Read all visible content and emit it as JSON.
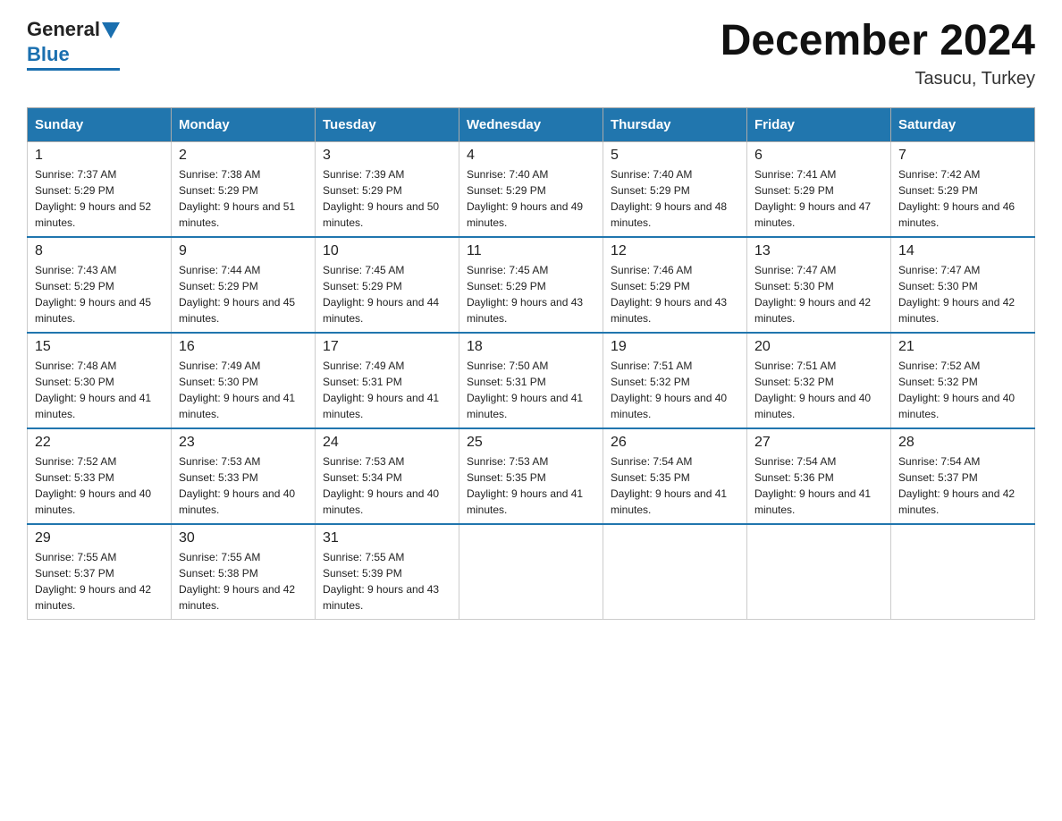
{
  "header": {
    "title": "December 2024",
    "subtitle": "Tasucu, Turkey",
    "logo_general": "General",
    "logo_blue": "Blue"
  },
  "days_of_week": [
    "Sunday",
    "Monday",
    "Tuesday",
    "Wednesday",
    "Thursday",
    "Friday",
    "Saturday"
  ],
  "weeks": [
    [
      {
        "day": "1",
        "sunrise": "7:37 AM",
        "sunset": "5:29 PM",
        "daylight": "9 hours and 52 minutes."
      },
      {
        "day": "2",
        "sunrise": "7:38 AM",
        "sunset": "5:29 PM",
        "daylight": "9 hours and 51 minutes."
      },
      {
        "day": "3",
        "sunrise": "7:39 AM",
        "sunset": "5:29 PM",
        "daylight": "9 hours and 50 minutes."
      },
      {
        "day": "4",
        "sunrise": "7:40 AM",
        "sunset": "5:29 PM",
        "daylight": "9 hours and 49 minutes."
      },
      {
        "day": "5",
        "sunrise": "7:40 AM",
        "sunset": "5:29 PM",
        "daylight": "9 hours and 48 minutes."
      },
      {
        "day": "6",
        "sunrise": "7:41 AM",
        "sunset": "5:29 PM",
        "daylight": "9 hours and 47 minutes."
      },
      {
        "day": "7",
        "sunrise": "7:42 AM",
        "sunset": "5:29 PM",
        "daylight": "9 hours and 46 minutes."
      }
    ],
    [
      {
        "day": "8",
        "sunrise": "7:43 AM",
        "sunset": "5:29 PM",
        "daylight": "9 hours and 45 minutes."
      },
      {
        "day": "9",
        "sunrise": "7:44 AM",
        "sunset": "5:29 PM",
        "daylight": "9 hours and 45 minutes."
      },
      {
        "day": "10",
        "sunrise": "7:45 AM",
        "sunset": "5:29 PM",
        "daylight": "9 hours and 44 minutes."
      },
      {
        "day": "11",
        "sunrise": "7:45 AM",
        "sunset": "5:29 PM",
        "daylight": "9 hours and 43 minutes."
      },
      {
        "day": "12",
        "sunrise": "7:46 AM",
        "sunset": "5:29 PM",
        "daylight": "9 hours and 43 minutes."
      },
      {
        "day": "13",
        "sunrise": "7:47 AM",
        "sunset": "5:30 PM",
        "daylight": "9 hours and 42 minutes."
      },
      {
        "day": "14",
        "sunrise": "7:47 AM",
        "sunset": "5:30 PM",
        "daylight": "9 hours and 42 minutes."
      }
    ],
    [
      {
        "day": "15",
        "sunrise": "7:48 AM",
        "sunset": "5:30 PM",
        "daylight": "9 hours and 41 minutes."
      },
      {
        "day": "16",
        "sunrise": "7:49 AM",
        "sunset": "5:30 PM",
        "daylight": "9 hours and 41 minutes."
      },
      {
        "day": "17",
        "sunrise": "7:49 AM",
        "sunset": "5:31 PM",
        "daylight": "9 hours and 41 minutes."
      },
      {
        "day": "18",
        "sunrise": "7:50 AM",
        "sunset": "5:31 PM",
        "daylight": "9 hours and 41 minutes."
      },
      {
        "day": "19",
        "sunrise": "7:51 AM",
        "sunset": "5:32 PM",
        "daylight": "9 hours and 40 minutes."
      },
      {
        "day": "20",
        "sunrise": "7:51 AM",
        "sunset": "5:32 PM",
        "daylight": "9 hours and 40 minutes."
      },
      {
        "day": "21",
        "sunrise": "7:52 AM",
        "sunset": "5:32 PM",
        "daylight": "9 hours and 40 minutes."
      }
    ],
    [
      {
        "day": "22",
        "sunrise": "7:52 AM",
        "sunset": "5:33 PM",
        "daylight": "9 hours and 40 minutes."
      },
      {
        "day": "23",
        "sunrise": "7:53 AM",
        "sunset": "5:33 PM",
        "daylight": "9 hours and 40 minutes."
      },
      {
        "day": "24",
        "sunrise": "7:53 AM",
        "sunset": "5:34 PM",
        "daylight": "9 hours and 40 minutes."
      },
      {
        "day": "25",
        "sunrise": "7:53 AM",
        "sunset": "5:35 PM",
        "daylight": "9 hours and 41 minutes."
      },
      {
        "day": "26",
        "sunrise": "7:54 AM",
        "sunset": "5:35 PM",
        "daylight": "9 hours and 41 minutes."
      },
      {
        "day": "27",
        "sunrise": "7:54 AM",
        "sunset": "5:36 PM",
        "daylight": "9 hours and 41 minutes."
      },
      {
        "day": "28",
        "sunrise": "7:54 AM",
        "sunset": "5:37 PM",
        "daylight": "9 hours and 42 minutes."
      }
    ],
    [
      {
        "day": "29",
        "sunrise": "7:55 AM",
        "sunset": "5:37 PM",
        "daylight": "9 hours and 42 minutes."
      },
      {
        "day": "30",
        "sunrise": "7:55 AM",
        "sunset": "5:38 PM",
        "daylight": "9 hours and 42 minutes."
      },
      {
        "day": "31",
        "sunrise": "7:55 AM",
        "sunset": "5:39 PM",
        "daylight": "9 hours and 43 minutes."
      },
      null,
      null,
      null,
      null
    ]
  ]
}
